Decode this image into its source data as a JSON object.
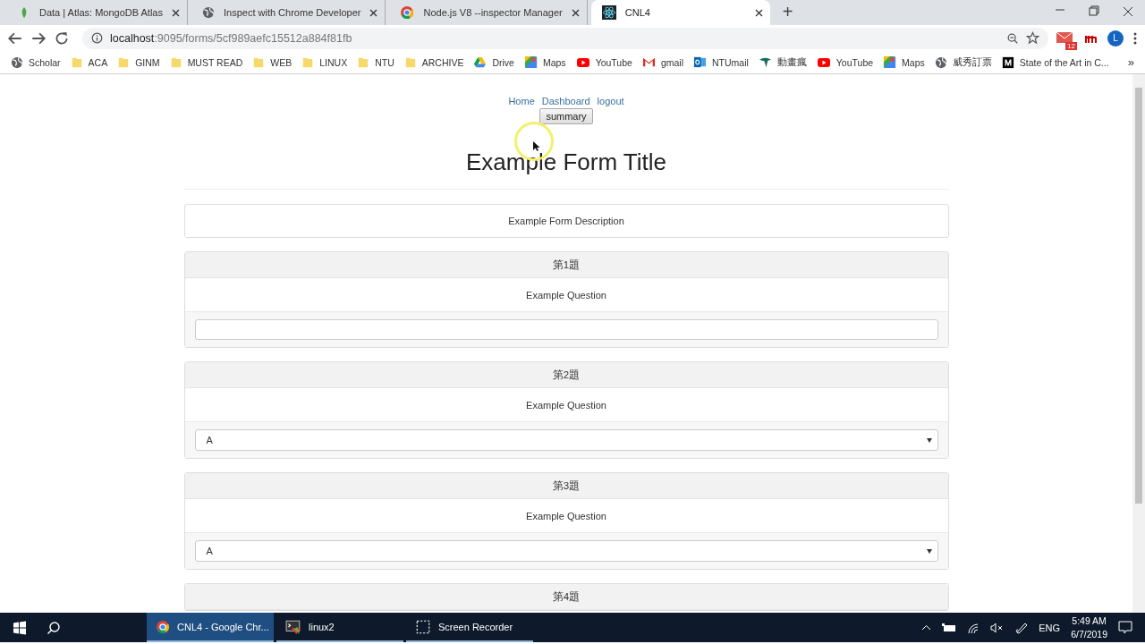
{
  "tabs": [
    {
      "title": "Data | Atlas: MongoDB Atlas",
      "kind": "leaf",
      "selected": false
    },
    {
      "title": "Inspect with Chrome Developer",
      "kind": "globe",
      "selected": false
    },
    {
      "title": "Node.js V8 --inspector Manager",
      "kind": "chrome",
      "selected": false
    },
    {
      "title": "CNL4",
      "kind": "react",
      "selected": true
    }
  ],
  "new_tab": "+",
  "address": {
    "host": "localhost",
    "path": ":9095/forms/5cf989aefc15512a884f81fb"
  },
  "extensions": {
    "mail_badge": "12",
    "profile": "L"
  },
  "bookmarks": [
    {
      "label": "Scholar",
      "kind": "globe"
    },
    {
      "label": "ACA",
      "kind": "folder"
    },
    {
      "label": "GINM",
      "kind": "folder"
    },
    {
      "label": "MUST READ",
      "kind": "folder"
    },
    {
      "label": "WEB",
      "kind": "folder"
    },
    {
      "label": "LINUX",
      "kind": "folder"
    },
    {
      "label": "NTU",
      "kind": "folder"
    },
    {
      "label": "ARCHIVE",
      "kind": "folder"
    },
    {
      "label": "Drive",
      "kind": "drive"
    },
    {
      "label": "Maps",
      "kind": "maps"
    },
    {
      "label": "YouTube",
      "kind": "youtube"
    },
    {
      "label": "gmail",
      "kind": "gmail"
    },
    {
      "label": "NTUmail",
      "kind": "outlook"
    },
    {
      "label": "動畫瘋",
      "kind": "bird"
    },
    {
      "label": "YouTube",
      "kind": "youtube"
    },
    {
      "label": "Maps",
      "kind": "maps"
    },
    {
      "label": "威秀訂票",
      "kind": "globe"
    },
    {
      "label": "State of the Art in C...",
      "kind": "medium"
    }
  ],
  "bookmarks_more": "»",
  "page": {
    "nav": [
      "Home",
      "Dashboard",
      "logout"
    ],
    "summary_button": "summary",
    "title": "Example Form Title",
    "description": "Example Form Description",
    "questions": [
      {
        "number": "第1題",
        "text": "Example Question",
        "kind": "text"
      },
      {
        "number": "第2題",
        "text": "Example Question",
        "kind": "select",
        "value": "A"
      },
      {
        "number": "第3題",
        "text": "Example Question",
        "kind": "select",
        "value": "A"
      },
      {
        "number": "第4題"
      }
    ]
  },
  "taskbar": {
    "items": [
      {
        "label": "CNL4 - Google Chr...",
        "kind": "chrome",
        "selected": true
      },
      {
        "label": "linux2",
        "kind": "terminal",
        "selected": false
      },
      {
        "label": "Screen Recorder",
        "kind": "recorder",
        "selected": false
      }
    ],
    "language": "ENG",
    "time": "5:49 AM",
    "date": "6/7/2019"
  }
}
